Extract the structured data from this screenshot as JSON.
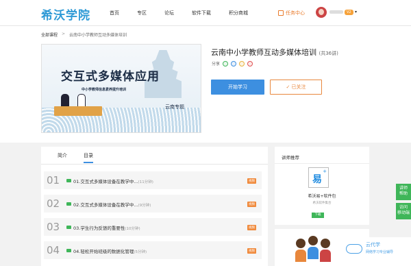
{
  "site": {
    "logo": "希沃学院"
  },
  "nav": [
    "首页",
    "专区",
    "论坛",
    "软件下载",
    "积分商城"
  ],
  "header": {
    "task_center": "任务中心",
    "vip_badge": "V2",
    "caret": "▾"
  },
  "breadcrumb": {
    "root": "全部课程",
    "sep": ">",
    "current": "云南中小学教师互动多媒体培训"
  },
  "banner": {
    "title": "交互式多媒体应用",
    "subtitle": "中小学教师信息素养提升培训",
    "region": "云南专题"
  },
  "course": {
    "title": "云南中小学教师互动多媒体培训",
    "count": "(共36讲)",
    "share_label": "分享",
    "start_button": "开始学习",
    "follow_button": "✓ 已关注"
  },
  "tabs": [
    "简介",
    "目录"
  ],
  "lessons": [
    {
      "num": "01",
      "title": "01.交互式多媒体设备在教学中...",
      "duration": "(11分钟)",
      "tag": "视频"
    },
    {
      "num": "02",
      "title": "02.交互式多媒体设备在教学中...",
      "duration": "(9分钟)",
      "tag": "视频"
    },
    {
      "num": "03",
      "title": "03.学生行为反馈的重要性",
      "duration": "(10分钟)",
      "tag": "视频"
    },
    {
      "num": "04",
      "title": "04.轻松开始班级的数据化管理",
      "duration": "(5分钟)",
      "tag": "视频"
    }
  ],
  "sidebar": {
    "heading": "讲师推荐",
    "app_glyph": "易",
    "app_plus": "+",
    "app_name": "希沃易+软件包",
    "app_desc": "希沃软件集合",
    "download": "下载"
  },
  "float_buttons": [
    "讲师\n帮助",
    "访问\n移动端"
  ],
  "promo": {
    "name": "云代学",
    "tagline": "网络学习专业辅导"
  },
  "colors": {
    "brand": "#2f9ad6",
    "accent": "#e8873c",
    "primary": "#3d8fe0",
    "green": "#3fb659"
  }
}
